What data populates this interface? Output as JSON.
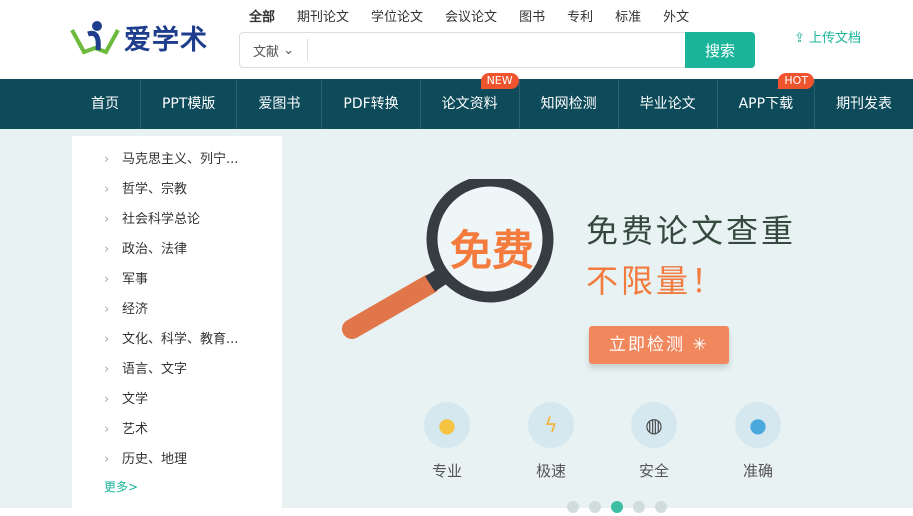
{
  "logo": {
    "text": "爱学术"
  },
  "search_categories": [
    "全部",
    "期刊论文",
    "学位论文",
    "会议论文",
    "图书",
    "专利",
    "标准",
    "外文"
  ],
  "search": {
    "scope": "文献",
    "button": "搜索",
    "placeholder": ""
  },
  "upload": "上传文档",
  "nav": [
    {
      "label": "首页"
    },
    {
      "label": "PPT模版"
    },
    {
      "label": "爱图书"
    },
    {
      "label": "PDF转换"
    },
    {
      "label": "论文资料",
      "badge": "NEW"
    },
    {
      "label": "知网检测"
    },
    {
      "label": "毕业论文"
    },
    {
      "label": "APP下载",
      "badge": "HOT"
    },
    {
      "label": "期刊发表"
    }
  ],
  "sidebar": {
    "items": [
      "马克思主义、列宁...",
      "哲学、宗教",
      "社会科学总论",
      "政治、法律",
      "军事",
      "经济",
      "文化、科学、教育...",
      "语言、文字",
      "文学",
      "艺术",
      "历史、地理"
    ],
    "more": "更多>"
  },
  "banner": {
    "magnifier_text": "免费",
    "title": "免费论文查重",
    "subtitle": "不限量！",
    "cta": "立即检测",
    "features": [
      {
        "label": "专业",
        "icon": "lightbulb-icon"
      },
      {
        "label": "极速",
        "icon": "lightning-icon"
      },
      {
        "label": "安全",
        "icon": "balloon-icon"
      },
      {
        "label": "准确",
        "icon": "location-pin-icon"
      }
    ],
    "slides": 5,
    "active_slide": 3
  },
  "colors": {
    "accent": "#19b49a",
    "nav_bg": "#0d4a5a",
    "orange": "#f0875d"
  }
}
